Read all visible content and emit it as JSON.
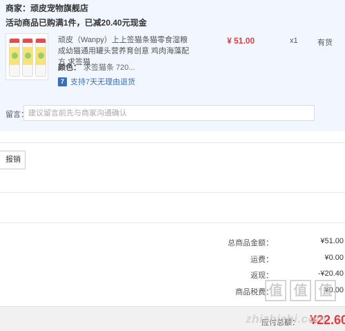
{
  "shop": {
    "merchant": "商家：顽皮宠物旗舰店",
    "promo": "活动商品已购满1件，已减20.40元现金"
  },
  "product": {
    "title": "顽皮（Wanpy）上上签猫条猫零食湿粮 成幼猫通用罐头营养育创意 鸡肉海藻配方 求签猫",
    "price": "¥ 51.00",
    "quantity": "x1",
    "stock": "有货",
    "color_label": "颜色：",
    "color_value": "求签猫条 720...",
    "return_badge": "7",
    "return_text": "支持7天无理由退货"
  },
  "message": {
    "label": "留言：",
    "placeholder": "建议留言前先与商家沟通确认"
  },
  "actions": {
    "report_label": "报销"
  },
  "summary": {
    "rows": [
      {
        "label": "总商品金额：",
        "value": "¥51.00"
      },
      {
        "label": "运费：",
        "value": "¥0.00"
      },
      {
        "label": "返现：",
        "value": "-¥20.40"
      },
      {
        "label": "商品税费：",
        "value": "¥0.00"
      }
    ],
    "payable_label": "应付总额：",
    "payable_amount": "¥22.60"
  },
  "watermark": {
    "chars": [
      "值",
      "值",
      "值"
    ],
    "url": "zhizhizhi.com"
  },
  "colors": {
    "panel_bg": "#f2f7ff",
    "price_red": "#e4393c",
    "link_blue": "#3a6fb7"
  }
}
